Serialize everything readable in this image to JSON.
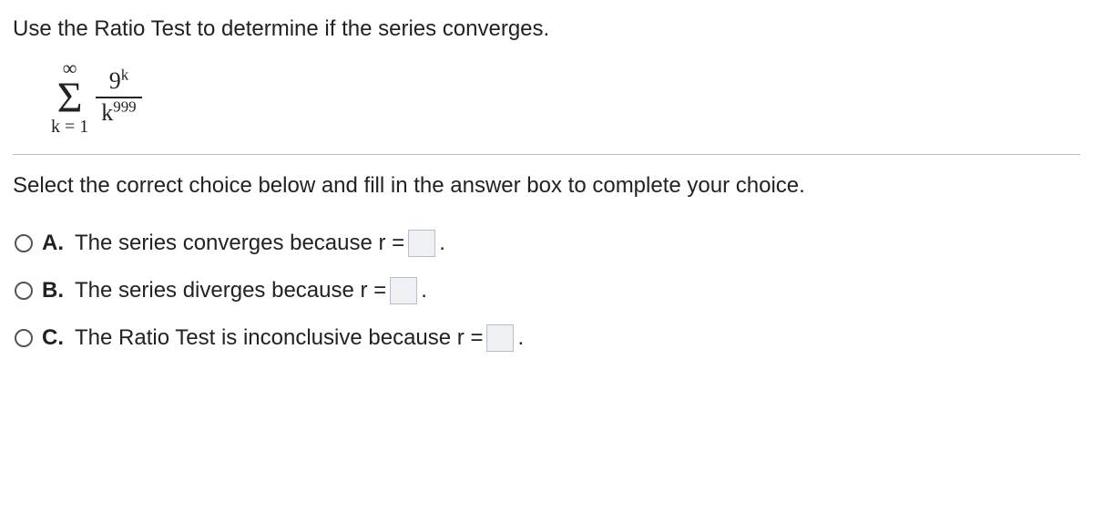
{
  "question": "Use the Ratio Test to determine if the series converges.",
  "formula": {
    "sigma_top": "∞",
    "sigma_symbol": "Σ",
    "sigma_bottom": "k = 1",
    "numerator_base": "9",
    "numerator_exp": "k",
    "denominator_base": "k",
    "denominator_exp": "999"
  },
  "instruction": "Select the correct choice below and fill in the answer box to complete your choice.",
  "choices": [
    {
      "letter": "A.",
      "before": "The series converges because r =",
      "after": "."
    },
    {
      "letter": "B.",
      "before": "The series diverges because r =",
      "after": "."
    },
    {
      "letter": "C.",
      "before": "The Ratio Test is inconclusive because r =",
      "after": "."
    }
  ]
}
